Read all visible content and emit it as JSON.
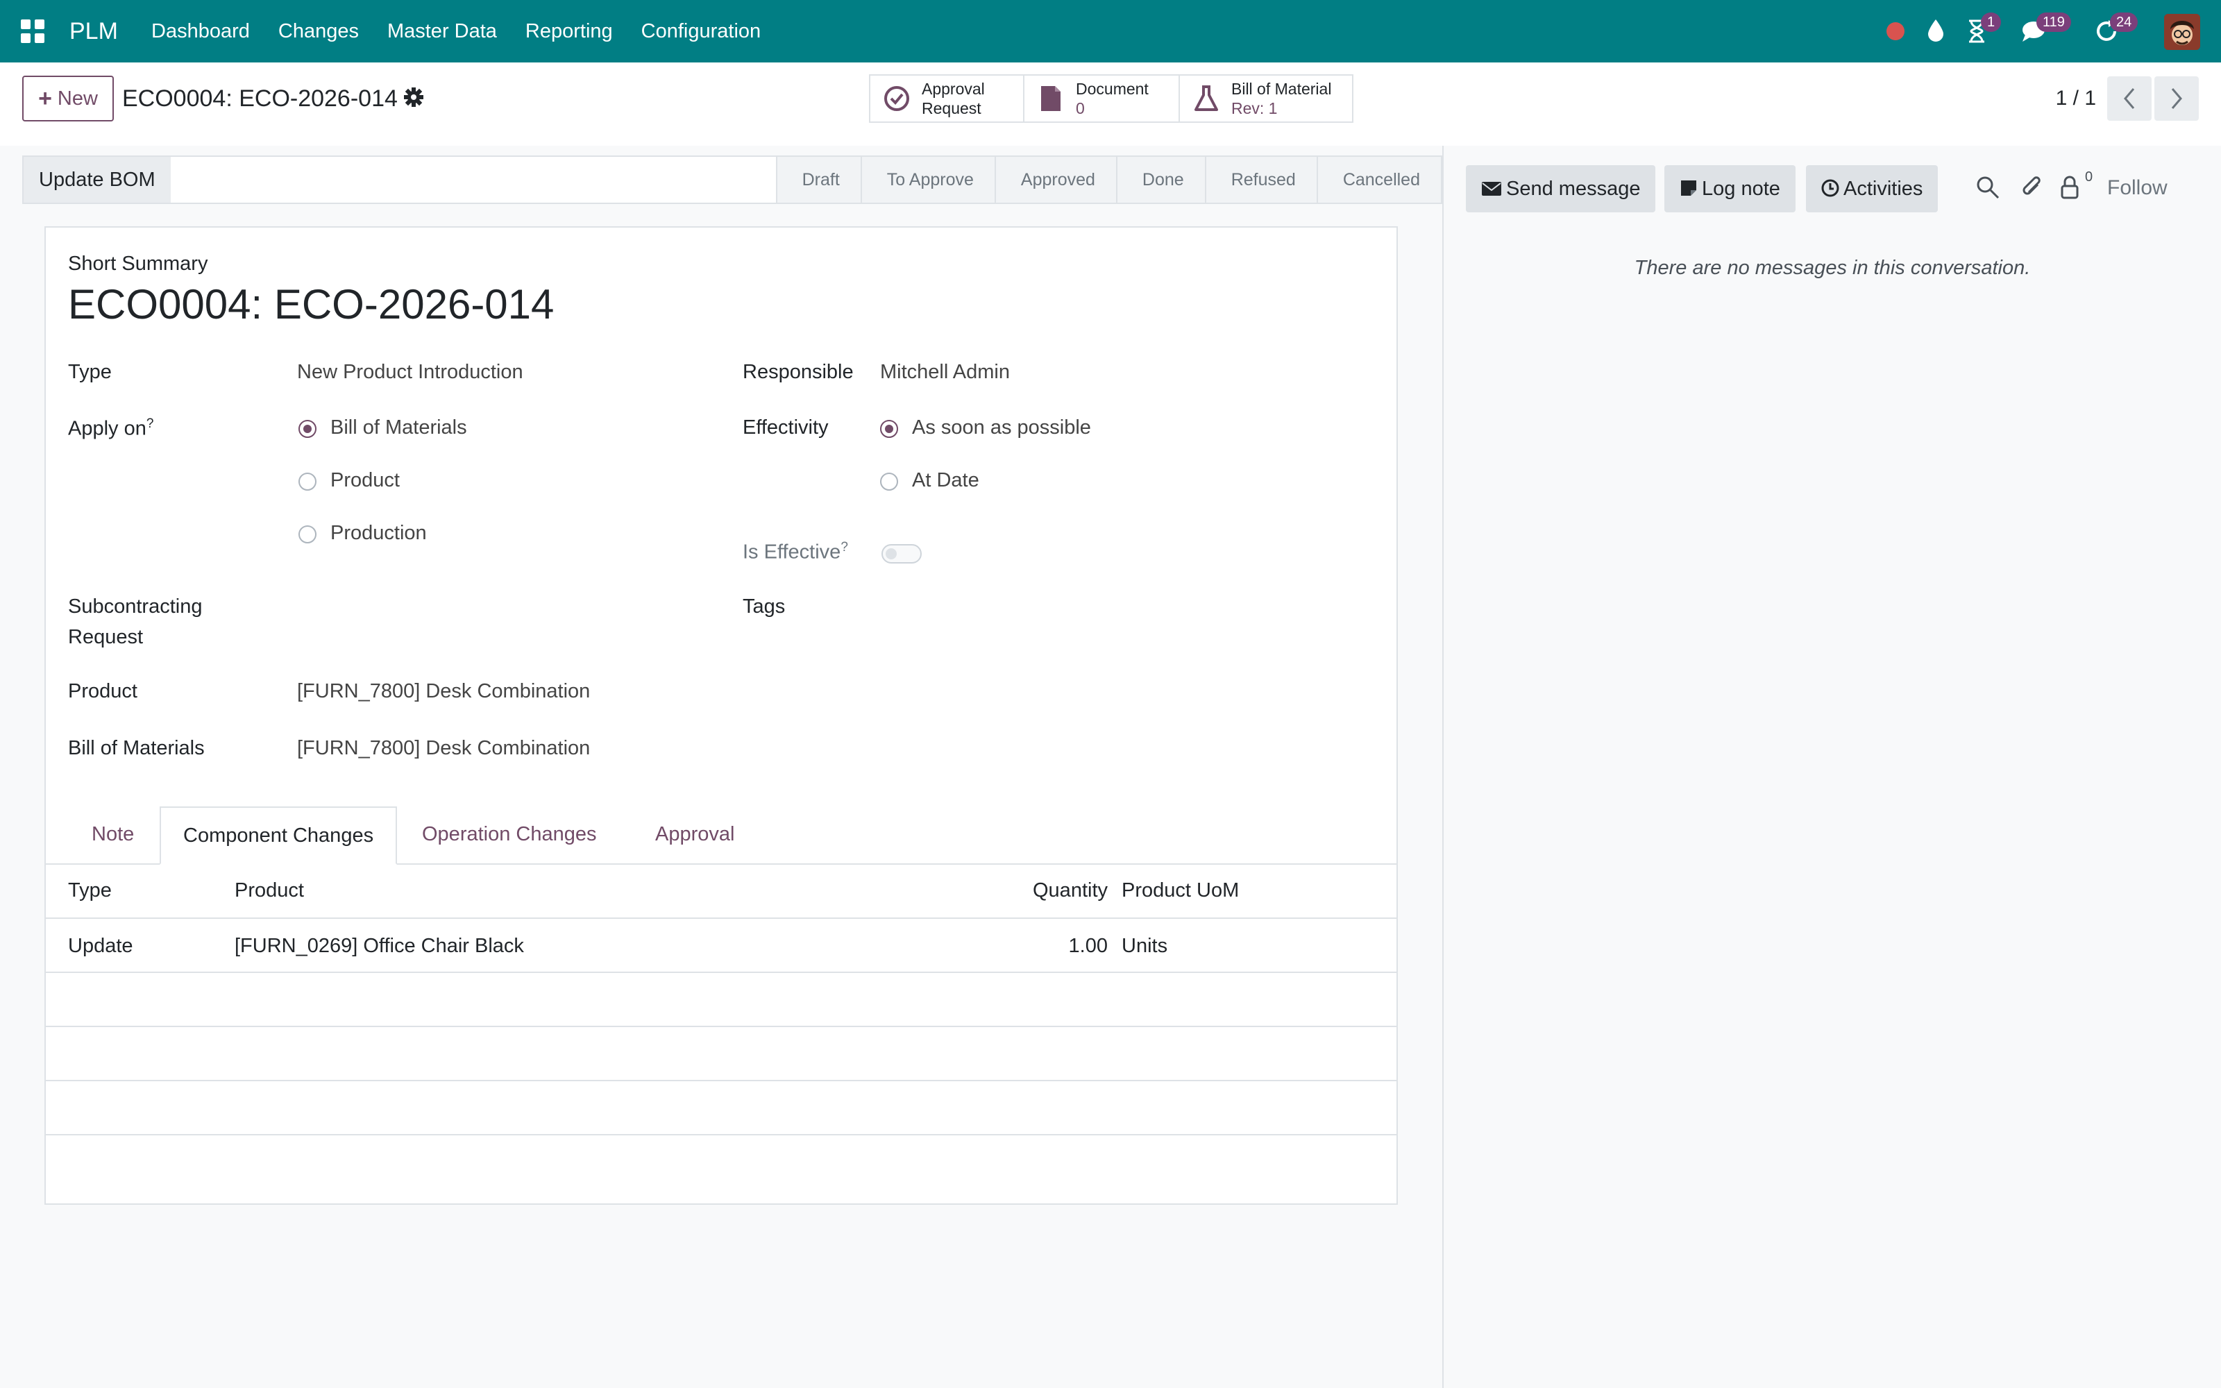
{
  "navbar": {
    "brand": "PLM",
    "menu": [
      "Dashboard",
      "Changes",
      "Master Data",
      "Reporting",
      "Configuration"
    ],
    "activity_badge": "1",
    "messages_badge": "119",
    "updates_badge": "24"
  },
  "control": {
    "new_label": "New",
    "record_title": "ECO0004: ECO-2026-014",
    "smart_buttons": [
      {
        "line1": "Approval",
        "line2": "Request",
        "icon": "check-circle-icon"
      },
      {
        "line1": "Document",
        "line2": "0",
        "icon": "file-icon"
      },
      {
        "line1": "Bill of Material",
        "line2": "Rev: 1",
        "icon": "flask-icon"
      }
    ],
    "pager": "1 / 1"
  },
  "statusbar": {
    "update_bom": "Update BOM",
    "stages": [
      "Draft",
      "To Approve",
      "Approved",
      "Done",
      "Refused",
      "Cancelled"
    ]
  },
  "form": {
    "short_summary_label": "Short Summary",
    "name": "ECO0004: ECO-2026-014",
    "type_label": "Type",
    "type_value": "New Product Introduction",
    "apply_on_label": "Apply on",
    "apply_on_options": [
      "Bill of Materials",
      "Product",
      "Production"
    ],
    "apply_on_selected": "Bill of Materials",
    "subcontracting_label_1": "Subcontracting",
    "subcontracting_label_2": "Request",
    "product_label": "Product",
    "product_value": "[FURN_7800] Desk Combination",
    "bom_label": "Bill of Materials",
    "bom_value": "[FURN_7800] Desk Combination",
    "responsible_label": "Responsible",
    "responsible_value": "Mitchell Admin",
    "effectivity_label": "Effectivity",
    "effectivity_options": [
      "As soon as possible",
      "At Date"
    ],
    "effectivity_selected": "As soon as possible",
    "is_effective_label": "Is Effective",
    "is_effective": false,
    "tags_label": "Tags",
    "help_mark": "?"
  },
  "tabs": [
    "Note",
    "Component Changes",
    "Operation Changes",
    "Approval"
  ],
  "active_tab": "Component Changes",
  "table": {
    "headers": [
      "Type",
      "Product",
      "Quantity",
      "Product UoM"
    ],
    "rows": [
      {
        "type": "Update",
        "product": "[FURN_0269] Office Chair Black",
        "quantity": "1.00",
        "uom": "Units"
      }
    ]
  },
  "chatter": {
    "send_message": "Send message",
    "log_note": "Log note",
    "activities": "Activities",
    "followers_count": "0",
    "follow": "Follow",
    "empty_text": "There are no messages in this conversation."
  },
  "colors": {
    "navbar": "#017e84",
    "accent": "#714b67",
    "badge": "#7b3f7b"
  }
}
